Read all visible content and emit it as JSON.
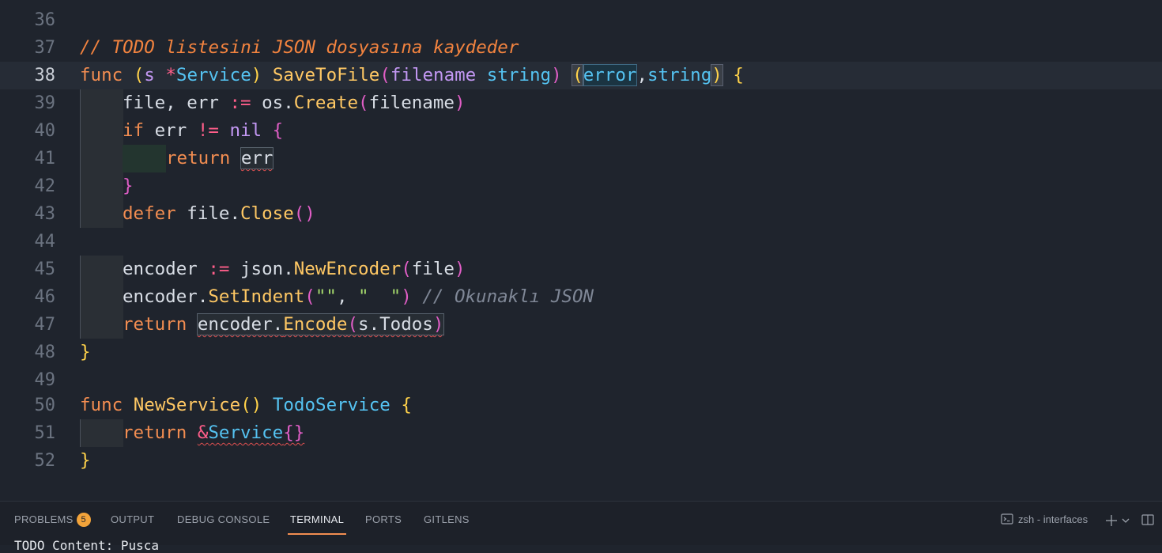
{
  "editor": {
    "lines": [
      {
        "n": "36"
      },
      {
        "n": "37",
        "comment": "// TODO listesini JSON dosyasına kaydeder"
      },
      {
        "n": "38",
        "t": [
          "func",
          " (",
          "s",
          " *",
          "Service",
          ") ",
          "SaveToFile",
          "(",
          "filename",
          " ",
          "string",
          ") ",
          "(",
          "error",
          ",",
          "string",
          ")",
          " {"
        ]
      },
      {
        "n": "39",
        "t": [
          "file, err ",
          ":=",
          " os.",
          "Create",
          "(",
          "filename",
          ")"
        ]
      },
      {
        "n": "40",
        "t": [
          "if",
          " err ",
          "!=",
          " nil ",
          "{"
        ]
      },
      {
        "n": "41",
        "t": [
          "return",
          " ",
          "err"
        ]
      },
      {
        "n": "42",
        "t": [
          "}"
        ]
      },
      {
        "n": "43",
        "t": [
          "defer",
          " file.",
          "Close",
          "()"
        ]
      },
      {
        "n": "44"
      },
      {
        "n": "45",
        "t": [
          "encoder ",
          ":=",
          " json.",
          "NewEncoder",
          "(",
          "file",
          ")"
        ]
      },
      {
        "n": "46",
        "t": [
          "encoder.",
          "SetIndent",
          "(",
          "\"\"",
          ", ",
          "\"  \"",
          ")",
          " ",
          "// Okunaklı JSON"
        ]
      },
      {
        "n": "47",
        "t": [
          "return",
          " ",
          "encoder.",
          "Encode",
          "(",
          "s.Todos",
          ")"
        ]
      },
      {
        "n": "48",
        "t": [
          "}"
        ]
      },
      {
        "n": "49"
      },
      {
        "n": "50",
        "t": [
          "func",
          " ",
          "NewService",
          "()",
          " ",
          "TodoService",
          " {"
        ]
      },
      {
        "n": "51",
        "t": [
          "return",
          " ",
          "&",
          "Service",
          "{}"
        ]
      },
      {
        "n": "52",
        "t": [
          "}"
        ]
      }
    ]
  },
  "panel": {
    "tabs": [
      {
        "label": "PROBLEMS"
      },
      {
        "label": "OUTPUT"
      },
      {
        "label": "DEBUG CONSOLE"
      },
      {
        "label": "TERMINAL"
      },
      {
        "label": "PORTS"
      },
      {
        "label": "GITLENS"
      }
    ],
    "problems_count": "5",
    "active_tab": "TERMINAL",
    "terminal_name": "zsh - interfaces",
    "terminal_output": "TODO Content: Pusca"
  },
  "colors": {
    "background": "#1f242d",
    "keyword": "#f28d51",
    "function": "#ffc864",
    "type": "#55c3f2",
    "accent": "#f28d51",
    "badge": "#f2a33a"
  },
  "icons": [
    "terminal-icon",
    "plus-icon",
    "chevron-down-icon",
    "split-panel-icon"
  ]
}
